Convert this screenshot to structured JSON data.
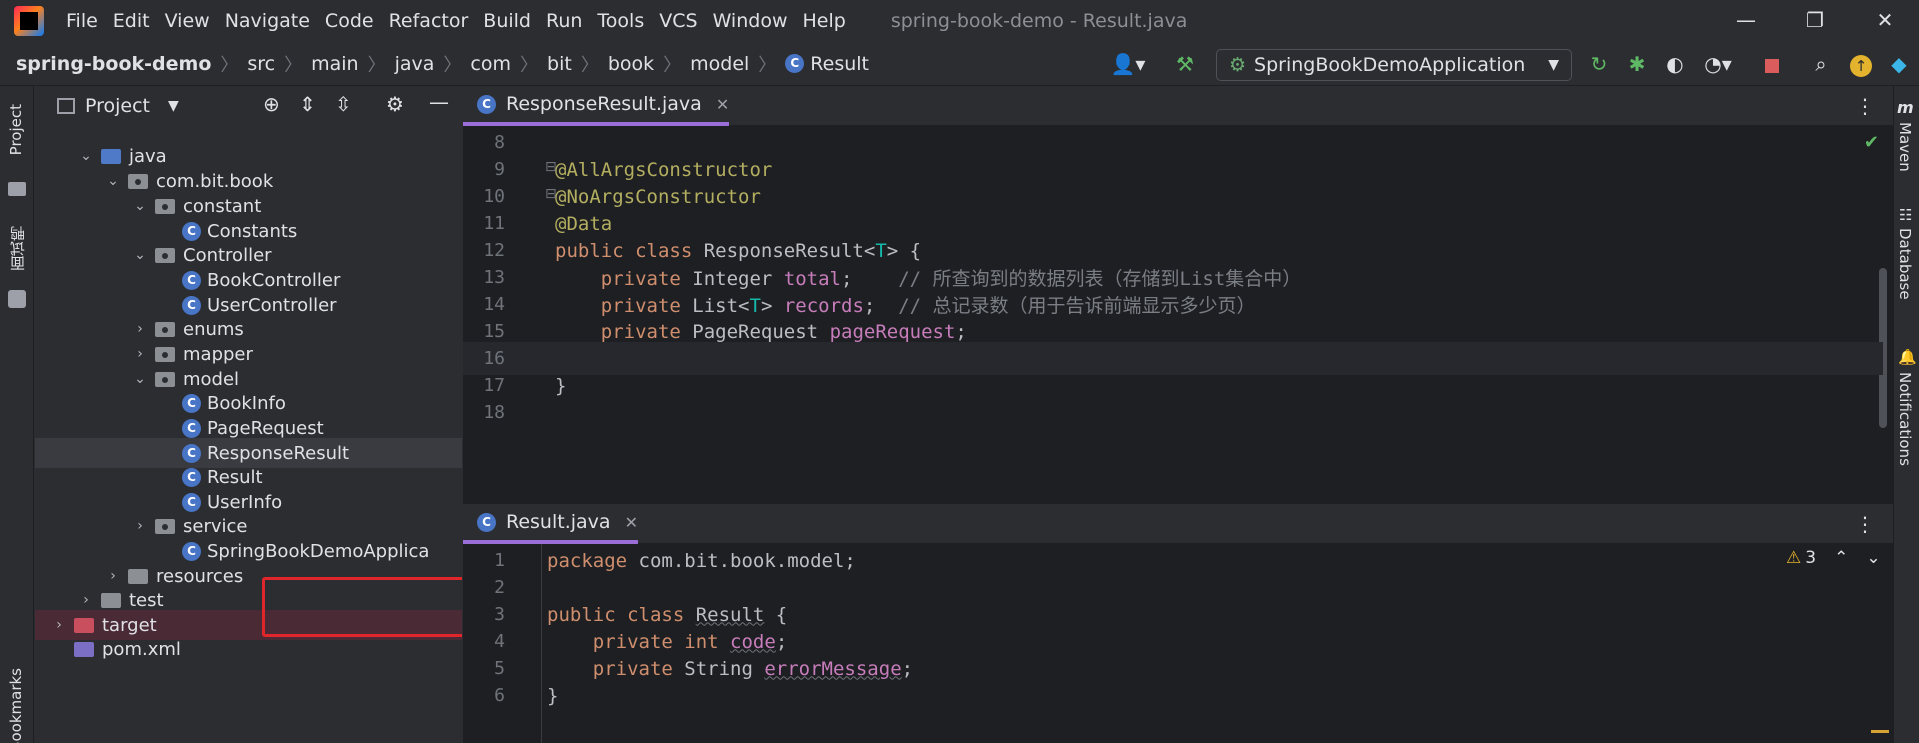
{
  "menu": {
    "items": [
      "File",
      "Edit",
      "View",
      "Navigate",
      "Code",
      "Refactor",
      "Build",
      "Run",
      "Tools",
      "VCS",
      "Window",
      "Help"
    ],
    "window_title": "spring-book-demo - Result.java"
  },
  "window_controls": {
    "minimize": "—",
    "restore": "❐",
    "close": "✕"
  },
  "breadcrumb": {
    "items": [
      "spring-book-demo",
      "src",
      "main",
      "java",
      "com",
      "bit",
      "book",
      "model",
      "Result"
    ],
    "separator": "〉"
  },
  "toolbar": {
    "run_config": "SpringBookDemoApplication",
    "icons": [
      "account-icon",
      "build-hammer-icon",
      "rerun-icon",
      "debug-icon",
      "coverage-icon",
      "profile-icon",
      "stop-icon",
      "search-icon",
      "update-icon",
      "toolbox-icon"
    ]
  },
  "left_strip": {
    "project_label": "Project",
    "interview_label": "面试鸭",
    "bookmarks_label": "Bookmarks"
  },
  "project_panel": {
    "title": "Project",
    "tree": [
      {
        "label": "java",
        "kind": "folder-blue",
        "expanded": true
      },
      {
        "label": "com.bit.book",
        "kind": "package",
        "expanded": true
      },
      {
        "label": "constant",
        "kind": "package",
        "expanded": true
      },
      {
        "label": "Constants",
        "kind": "class"
      },
      {
        "label": "Controller",
        "kind": "package",
        "expanded": true
      },
      {
        "label": "BookController",
        "kind": "class"
      },
      {
        "label": "UserController",
        "kind": "class"
      },
      {
        "label": "enums",
        "kind": "package",
        "expanded": false
      },
      {
        "label": "mapper",
        "kind": "package",
        "expanded": false
      },
      {
        "label": "model",
        "kind": "package",
        "expanded": true
      },
      {
        "label": "BookInfo",
        "kind": "class"
      },
      {
        "label": "PageRequest",
        "kind": "class"
      },
      {
        "label": "ResponseResult",
        "kind": "class"
      },
      {
        "label": "Result",
        "kind": "class"
      },
      {
        "label": "UserInfo",
        "kind": "class"
      },
      {
        "label": "service",
        "kind": "package",
        "expanded": false
      },
      {
        "label": "SpringBookDemoApplica",
        "kind": "spring-class"
      },
      {
        "label": "resources",
        "kind": "folder",
        "expanded": false
      },
      {
        "label": "test",
        "kind": "folder",
        "expanded": false
      },
      {
        "label": "target",
        "kind": "folder-red",
        "expanded": false
      },
      {
        "label": "pom.xml",
        "kind": "file"
      }
    ]
  },
  "editor_top": {
    "tab_label": "ResponseResult.java",
    "lines": [
      {
        "n": "8",
        "tokens": []
      },
      {
        "n": "9",
        "tokens": [
          [
            "ann",
            "@AllArgsConstructor"
          ]
        ]
      },
      {
        "n": "10",
        "tokens": [
          [
            "ann",
            "@NoArgsConstructor"
          ]
        ]
      },
      {
        "n": "11",
        "tokens": [
          [
            "ann",
            "@Data"
          ]
        ]
      },
      {
        "n": "12",
        "tokens": [
          [
            "kw",
            "public class "
          ],
          [
            "plain",
            "ResponseResult<"
          ],
          [
            "type-p",
            "T"
          ],
          [
            "plain",
            "> {"
          ]
        ]
      },
      {
        "n": "13",
        "tokens": [
          [
            "plain",
            "    "
          ],
          [
            "kw",
            "private "
          ],
          [
            "plain",
            "Integer "
          ],
          [
            "field",
            "total"
          ],
          [
            "plain",
            ";    "
          ],
          [
            "cmt",
            "// 所查询到的数据列表（存储到List集合中）"
          ]
        ]
      },
      {
        "n": "14",
        "tokens": [
          [
            "plain",
            "    "
          ],
          [
            "kw",
            "private "
          ],
          [
            "plain",
            "List<"
          ],
          [
            "type-p",
            "T"
          ],
          [
            "plain",
            "> "
          ],
          [
            "field",
            "records"
          ],
          [
            "plain",
            ";  "
          ],
          [
            "cmt",
            "// 总记录数（用于告诉前端显示多少页）"
          ]
        ]
      },
      {
        "n": "15",
        "tokens": [
          [
            "plain",
            "    "
          ],
          [
            "kw",
            "private "
          ],
          [
            "plain",
            "PageRequest "
          ],
          [
            "field",
            "pageRequest"
          ],
          [
            "plain",
            ";"
          ]
        ]
      },
      {
        "n": "16",
        "tokens": []
      },
      {
        "n": "17",
        "tokens": [
          [
            "plain",
            "}"
          ]
        ]
      },
      {
        "n": "18",
        "tokens": []
      }
    ]
  },
  "editor_bottom": {
    "tab_label": "Result.java",
    "warning_count": "3",
    "lines": [
      {
        "n": "1",
        "tokens": [
          [
            "kw",
            "package "
          ],
          [
            "plain",
            "com.bit.book.model;"
          ]
        ]
      },
      {
        "n": "2",
        "tokens": []
      },
      {
        "n": "3",
        "tokens": [
          [
            "kw",
            "public class "
          ],
          [
            "plain-u",
            "Result"
          ],
          [
            "plain",
            " {"
          ]
        ]
      },
      {
        "n": "4",
        "tokens": [
          [
            "plain",
            "    "
          ],
          [
            "kw",
            "private int "
          ],
          [
            "field-u",
            "code"
          ],
          [
            "plain",
            ";"
          ]
        ]
      },
      {
        "n": "5",
        "tokens": [
          [
            "plain",
            "    "
          ],
          [
            "kw",
            "private "
          ],
          [
            "plain",
            "String "
          ],
          [
            "field-u",
            "errorMessage"
          ],
          [
            "plain",
            ";"
          ]
        ]
      },
      {
        "n": "6",
        "tokens": [
          [
            "plain",
            "}"
          ]
        ]
      }
    ]
  },
  "right_strip": {
    "labels": [
      "Maven",
      "Database",
      "Notifications"
    ]
  }
}
